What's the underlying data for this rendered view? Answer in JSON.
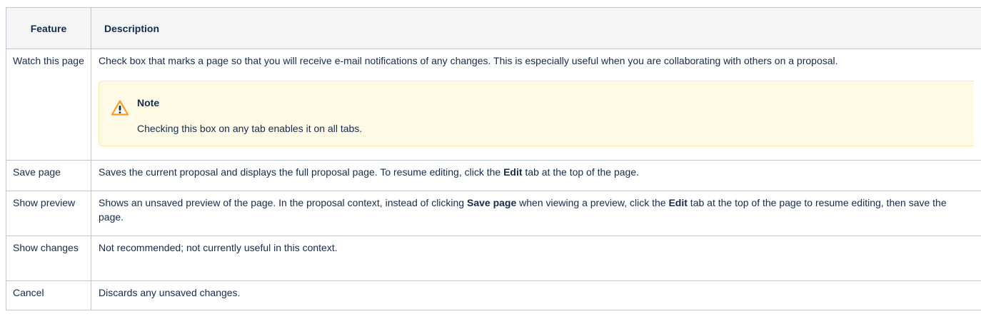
{
  "table": {
    "headers": [
      "Feature",
      "Description"
    ],
    "rows": [
      {
        "feature": "Watch this page",
        "description": "Check box that marks a page so that you will receive e-mail notifications of any changes. This is especially useful when you are collaborating with others on a proposal.",
        "note": {
          "title": "Note",
          "body": "Checking this box on any tab enables it on all tabs.",
          "icon": "warning-icon"
        }
      },
      {
        "feature": "Save page",
        "description_parts": {
          "before": "Saves the current proposal and displays the full proposal page. To resume editing, click the ",
          "bold": "Edit",
          "after": " tab at the top of the page."
        }
      },
      {
        "feature": "Show preview",
        "description_parts": {
          "before": "Shows an unsaved preview of the page. In the proposal context, instead of clicking ",
          "bold1": "Save page",
          "middle": " when viewing a preview, click the ",
          "bold2": "Edit",
          "after": " tab at the top of the page to resume editing, then save the page."
        }
      },
      {
        "feature": "Show changes",
        "description": "Not recommended; not currently useful in this context."
      },
      {
        "feature": "Cancel",
        "description": "Discards any unsaved changes."
      }
    ]
  },
  "colors": {
    "border": "#c1c7d0",
    "header_bg": "#f4f5f7",
    "note_bg": "#fffae6",
    "note_border": "#ffe7a0",
    "warning_icon": "#ff991f"
  }
}
